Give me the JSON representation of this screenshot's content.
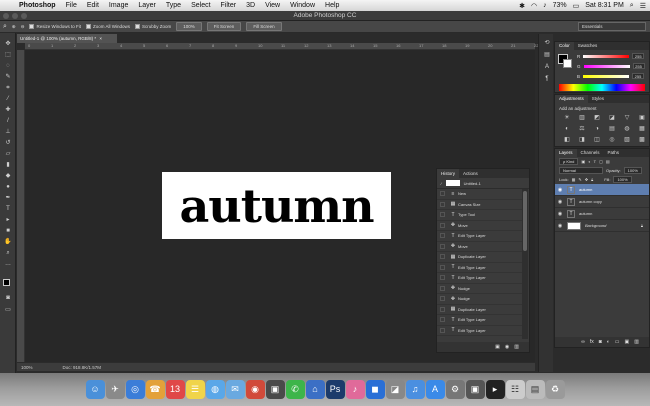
{
  "menubar": {
    "app": "Photoshop",
    "items": [
      "File",
      "Edit",
      "Image",
      "Layer",
      "Type",
      "Select",
      "Filter",
      "3D",
      "View",
      "Window",
      "Help"
    ],
    "battery": "73%",
    "clock": "Sat 8:31 PM"
  },
  "window": {
    "title": "Adobe Photoshop CC"
  },
  "options": {
    "resize_windows_label": "Resize Windows to Fit",
    "zoom_all_label": "Zoom All Windows",
    "scrubby_zoom_label": "Scrubby Zoom",
    "zoom_100": "100%",
    "fit_screen": "Fit Screen",
    "fill_screen": "Fill Screen",
    "workspace": "Essentials"
  },
  "document": {
    "tab_label": "Untitled-1 @ 100% (autumn, RGB/8) *",
    "canvas_text": "autumn",
    "zoom": "100%",
    "doc_size": "Doc: 918.8K/1.57M",
    "ruler_ticks": [
      "0",
      "1",
      "2",
      "3",
      "4",
      "5",
      "6",
      "7",
      "8",
      "9",
      "10",
      "11",
      "12",
      "13",
      "14",
      "15",
      "16",
      "17",
      "18",
      "19",
      "20",
      "21",
      "22"
    ]
  },
  "history": {
    "tabs": [
      "History",
      "Actions"
    ],
    "snapshot": "Untitled-1",
    "items": [
      {
        "icon": "≡",
        "label": "New"
      },
      {
        "icon": "▦",
        "label": "Canvas Size"
      },
      {
        "icon": "T",
        "label": "Type Tool"
      },
      {
        "icon": "✥",
        "label": "Move"
      },
      {
        "icon": "T",
        "label": "Edit Type Layer"
      },
      {
        "icon": "✥",
        "label": "Move"
      },
      {
        "icon": "▦",
        "label": "Duplicate Layer"
      },
      {
        "icon": "T",
        "label": "Edit Type Layer"
      },
      {
        "icon": "T",
        "label": "Edit Type Layer"
      },
      {
        "icon": "✥",
        "label": "Nudge"
      },
      {
        "icon": "✥",
        "label": "Nudge"
      },
      {
        "icon": "▦",
        "label": "Duplicate Layer"
      },
      {
        "icon": "T",
        "label": "Edit Type Layer"
      },
      {
        "icon": "T",
        "label": "Edit Type Layer"
      }
    ]
  },
  "color_panel": {
    "tabs": [
      "Color",
      "Swatches"
    ],
    "r": "255",
    "g": "255",
    "b": "255"
  },
  "adjustments": {
    "tabs": [
      "Adjustments",
      "Styles"
    ],
    "title": "Add an adjustment",
    "icons": [
      "☀",
      "▥",
      "◩",
      "◪",
      "▽",
      "▣",
      "◐",
      "⚖",
      "◑",
      "▤",
      "◍",
      "▦",
      "◧",
      "◨",
      "◫",
      "◎",
      "▧",
      "▩"
    ]
  },
  "layers": {
    "tabs": [
      "Layers",
      "Channels",
      "Paths"
    ],
    "kind_label": "ρ Kind",
    "blend_mode": "Normal",
    "opacity_label": "Opacity:",
    "opacity": "100%",
    "lock_label": "Lock:",
    "fill_label": "Fill:",
    "fill": "100%",
    "items": [
      {
        "name": "autumn",
        "type": "T",
        "selected": true
      },
      {
        "name": "autumn copy",
        "type": "T",
        "selected": false
      },
      {
        "name": "autumn",
        "type": "T",
        "selected": false
      },
      {
        "name": "Background",
        "type": "bg",
        "selected": false
      }
    ]
  },
  "dock": {
    "apps": [
      {
        "icon": "☺",
        "color": "#4a90d9"
      },
      {
        "icon": "✈",
        "color": "#8a8a8a"
      },
      {
        "icon": "◎",
        "color": "#3b7dd8"
      },
      {
        "icon": "☎",
        "color": "#e3a13a"
      },
      {
        "icon": "13",
        "color": "#e04848"
      },
      {
        "icon": "☰",
        "color": "#f0d44a"
      },
      {
        "icon": "◍",
        "color": "#5aa7e8"
      },
      {
        "icon": "✉",
        "color": "#6aa9e0"
      },
      {
        "icon": "◉",
        "color": "#d14a3a"
      },
      {
        "icon": "▣",
        "color": "#4a4a4a"
      },
      {
        "icon": "✆",
        "color": "#3db54a"
      },
      {
        "icon": "⌂",
        "color": "#3b6fc5"
      },
      {
        "icon": "Ps",
        "color": "#1c3b6b"
      },
      {
        "icon": "♪",
        "color": "#e06a9a"
      },
      {
        "icon": "◼",
        "color": "#2a6fd6"
      },
      {
        "icon": "◪",
        "color": "#888888"
      },
      {
        "icon": "♫",
        "color": "#4a8fe0"
      },
      {
        "icon": "A",
        "color": "#3a8ae8"
      },
      {
        "icon": "⚙",
        "color": "#777777"
      },
      {
        "icon": "▣",
        "color": "#555555"
      },
      {
        "icon": "▸",
        "color": "#222222"
      },
      {
        "icon": "☷",
        "color": "#cccccc"
      },
      {
        "icon": "▤",
        "color": "#bbbbbb"
      },
      {
        "icon": "♻",
        "color": "#9a9a9a"
      }
    ]
  }
}
